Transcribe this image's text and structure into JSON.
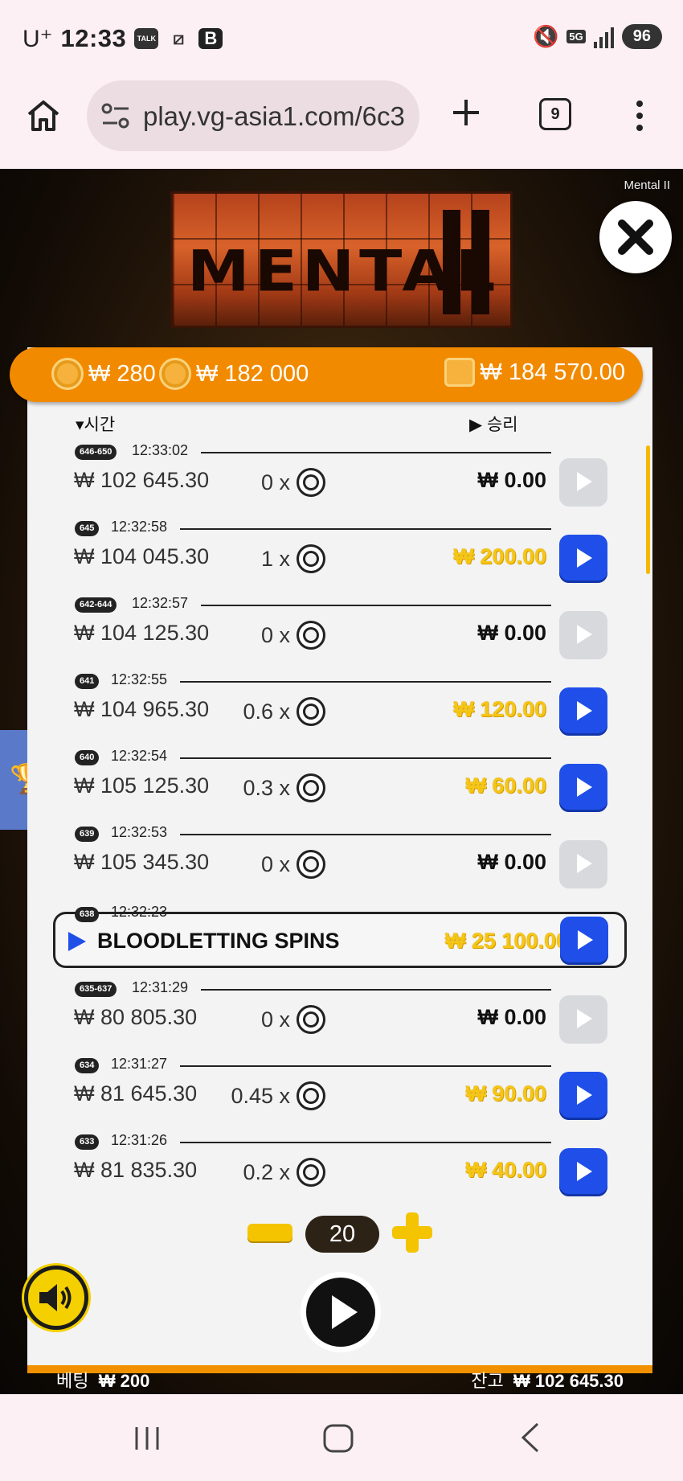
{
  "status_bar": {
    "carrier": "U⁺",
    "time": "12:33",
    "icons": [
      "talk-icon",
      "data-saver-icon",
      "b-app-icon"
    ],
    "network": "5G",
    "battery": "96"
  },
  "browser": {
    "url": "play.vg-asia1.com/6c3",
    "tab_count": "9"
  },
  "game": {
    "title_label": "Mental II",
    "header": {
      "coin_1": "₩ 280",
      "coin_2": "₩ 182 000",
      "wallet": "₩ 184 570.00"
    },
    "columns": {
      "time": "▾시간",
      "win": "▶ 승리"
    },
    "rows": [
      {
        "id": "646-650",
        "time": "12:33:02",
        "balance": "₩ 102 645.30",
        "mult": "0 x",
        "win": "₩ 0.00",
        "gold": false
      },
      {
        "id": "645",
        "time": "12:32:58",
        "balance": "₩ 104 045.30",
        "mult": "1 x",
        "win": "₩ 200.00",
        "gold": true
      },
      {
        "id": "642-644",
        "time": "12:32:57",
        "balance": "₩ 104 125.30",
        "mult": "0 x",
        "win": "₩ 0.00",
        "gold": false
      },
      {
        "id": "641",
        "time": "12:32:55",
        "balance": "₩ 104 965.30",
        "mult": "0.6 x",
        "win": "₩ 120.00",
        "gold": true
      },
      {
        "id": "640",
        "time": "12:32:54",
        "balance": "₩ 105 125.30",
        "mult": "0.3 x",
        "win": "₩ 60.00",
        "gold": true
      },
      {
        "id": "639",
        "time": "12:32:53",
        "balance": "₩ 105 345.30",
        "mult": "0 x",
        "win": "₩ 0.00",
        "gold": false
      }
    ],
    "bonus": {
      "id": "638",
      "time": "12:32:23",
      "label": "BLOODLETTING SPINS",
      "win": "₩ 25 100.00"
    },
    "rows_after": [
      {
        "id": "635-637",
        "time": "12:31:29",
        "balance": "₩ 80 805.30",
        "mult": "0 x",
        "win": "₩ 0.00",
        "gold": false
      },
      {
        "id": "634",
        "time": "12:31:27",
        "balance": "₩ 81 645.30",
        "mult": "0.45 x",
        "win": "₩ 90.00",
        "gold": true
      },
      {
        "id": "633",
        "time": "12:31:26",
        "balance": "₩ 81 835.30",
        "mult": "0.2 x",
        "win": "₩ 40.00",
        "gold": true
      }
    ],
    "bet_level": "20",
    "bet_label": "베팅",
    "bet_value": "₩ 200",
    "balance_label": "잔고",
    "balance_value": "₩ 102 645.30"
  },
  "colors": {
    "accent_orange": "#f28a00",
    "play_blue": "#1f4fe8",
    "win_gold": "#f6c615",
    "stepper_yellow": "#f4c400"
  }
}
